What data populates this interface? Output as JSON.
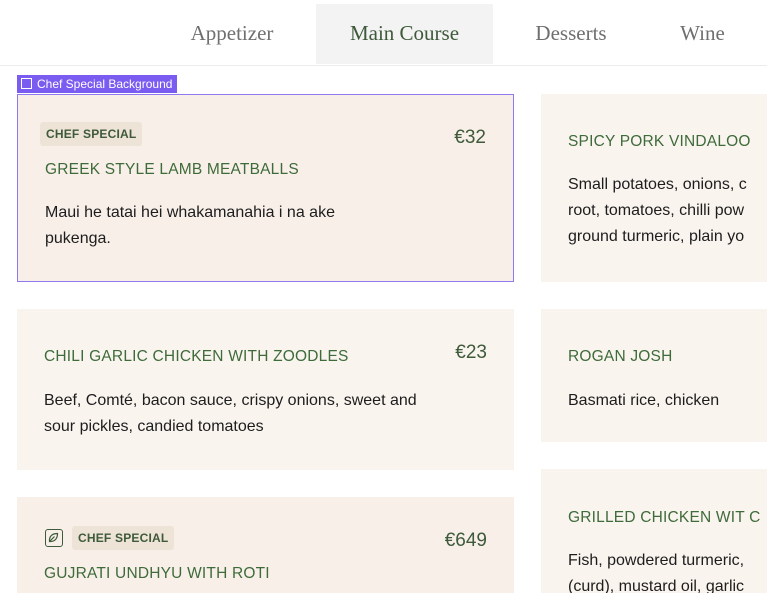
{
  "tabs": [
    {
      "label": "Appetizer"
    },
    {
      "label": "Main Course"
    },
    {
      "label": "Desserts"
    },
    {
      "label": "Wine"
    }
  ],
  "editor_label": "Chef Special Background",
  "left_cards": [
    {
      "badge": "CHEF SPECIAL",
      "title": "GREEK STYLE LAMB MEATBALLS",
      "price": "€32",
      "description": "Maui he tatai hei whakamanahia i na ake pukenga."
    },
    {
      "title": "CHILI GARLIC CHICKEN WITH ZOODLES",
      "price": "€23",
      "description": "Beef, Comté, bacon sauce, crispy onions, sweet and sour pickles, candied tomatoes"
    },
    {
      "badge": "CHEF SPECIAL",
      "icon": "leaf-icon",
      "title": "GUJRATI UNDHYU WITH ROTI",
      "price": "€649"
    }
  ],
  "right_cards": [
    {
      "title": "SPICY PORK VINDALOO",
      "description_lines": [
        "Small potatoes, onions, c",
        "root, tomatoes, chilli pow",
        "ground turmeric, plain yo"
      ]
    },
    {
      "title": "ROGAN JOSH",
      "description_lines": [
        "Basmati rice, chicken"
      ]
    },
    {
      "title": "GRILLED CHICKEN WIT C",
      "description_lines": [
        "Fish, powdered turmeric,",
        "(curd), mustard oil, garlic"
      ]
    }
  ],
  "colors": {
    "accent_green": "#3e6b3a",
    "card_bg": "#faf4ef",
    "selection": "#7b5cf0"
  }
}
